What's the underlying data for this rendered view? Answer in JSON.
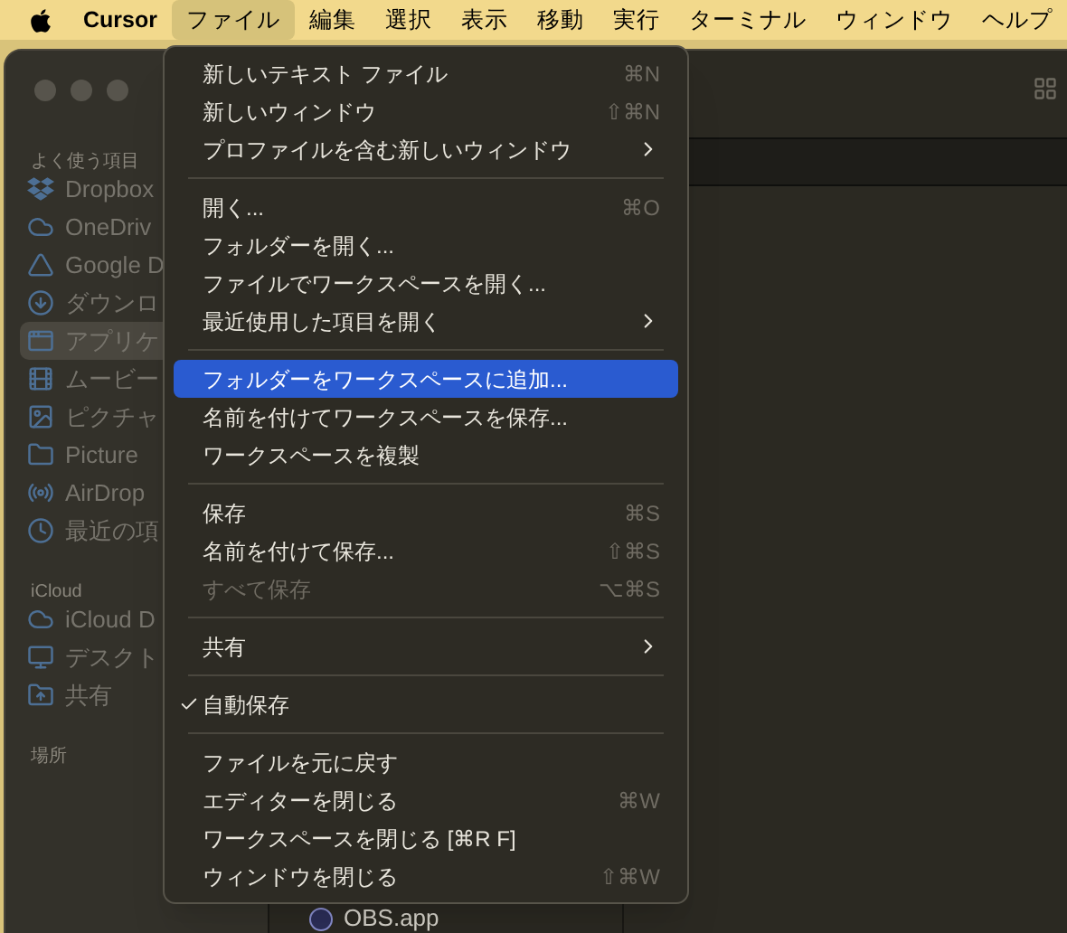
{
  "menu_bar": {
    "app_name": "Cursor",
    "menus": [
      {
        "label": "ファイル",
        "selected": true
      },
      {
        "label": "編集",
        "selected": false
      },
      {
        "label": "選択",
        "selected": false
      },
      {
        "label": "表示",
        "selected": false
      },
      {
        "label": "移動",
        "selected": false
      },
      {
        "label": "実行",
        "selected": false
      },
      {
        "label": "ターミナル",
        "selected": false
      },
      {
        "label": "ウィンドウ",
        "selected": false
      },
      {
        "label": "ヘルプ",
        "selected": false
      }
    ]
  },
  "sidebar": {
    "sections": [
      {
        "title": "よく使う項目",
        "items": [
          {
            "label": "Dropbox",
            "selected": false
          },
          {
            "label": "OneDriv",
            "selected": false
          },
          {
            "label": "Google D",
            "selected": false
          },
          {
            "label": "ダウンロ",
            "selected": false
          },
          {
            "label": "アプリケ",
            "selected": true
          },
          {
            "label": "ムービー",
            "selected": false
          },
          {
            "label": "ピクチャ",
            "selected": false
          },
          {
            "label": "Picture",
            "selected": false
          },
          {
            "label": "AirDrop",
            "selected": false
          },
          {
            "label": "最近の項",
            "selected": false
          }
        ]
      },
      {
        "title": "iCloud",
        "items": [
          {
            "label": "iCloud D",
            "selected": false
          },
          {
            "label": "デスクト",
            "selected": false
          },
          {
            "label": "共有",
            "selected": false
          }
        ]
      },
      {
        "title": "場所"
      }
    ]
  },
  "file_list": [
    {
      "label": "OBS.app"
    }
  ],
  "file_menu": {
    "groups": [
      [
        {
          "label": "新しいテキスト ファイル",
          "shortcut": "⌘N",
          "submenu": false,
          "selected": false,
          "disabled": false,
          "checked": false
        },
        {
          "label": "新しいウィンドウ",
          "shortcut": "⇧⌘N",
          "submenu": false,
          "selected": false,
          "disabled": false,
          "checked": false
        },
        {
          "label": "プロファイルを含む新しいウィンドウ",
          "submenu": true,
          "selected": false,
          "disabled": false,
          "checked": false
        }
      ],
      [
        {
          "label": "開く...",
          "shortcut": "⌘O",
          "submenu": false,
          "selected": false,
          "disabled": false,
          "checked": false
        },
        {
          "label": "フォルダーを開く...",
          "submenu": false,
          "selected": false,
          "disabled": false,
          "checked": false
        },
        {
          "label": "ファイルでワークスペースを開く...",
          "submenu": false,
          "selected": false,
          "disabled": false,
          "checked": false
        },
        {
          "label": "最近使用した項目を開く",
          "submenu": true,
          "selected": false,
          "disabled": false,
          "checked": false
        }
      ],
      [
        {
          "label": "フォルダーをワークスペースに追加...",
          "submenu": false,
          "selected": true,
          "disabled": false,
          "checked": false
        },
        {
          "label": "名前を付けてワークスペースを保存...",
          "submenu": false,
          "selected": false,
          "disabled": false,
          "checked": false
        },
        {
          "label": "ワークスペースを複製",
          "submenu": false,
          "selected": false,
          "disabled": false,
          "checked": false
        }
      ],
      [
        {
          "label": "保存",
          "shortcut": "⌘S",
          "submenu": false,
          "selected": false,
          "disabled": false,
          "checked": false
        },
        {
          "label": "名前を付けて保存...",
          "shortcut": "⇧⌘S",
          "submenu": false,
          "selected": false,
          "disabled": false,
          "checked": false
        },
        {
          "label": "すべて保存",
          "shortcut": "⌥⌘S",
          "submenu": false,
          "selected": false,
          "disabled": true,
          "checked": false
        }
      ],
      [
        {
          "label": "共有",
          "submenu": true,
          "selected": false,
          "disabled": false,
          "checked": false
        }
      ],
      [
        {
          "label": "自動保存",
          "submenu": false,
          "selected": false,
          "disabled": false,
          "checked": true
        }
      ],
      [
        {
          "label": "ファイルを元に戻す",
          "submenu": false,
          "selected": false,
          "disabled": false,
          "checked": false
        },
        {
          "label": "エディターを閉じる",
          "shortcut": "⌘W",
          "submenu": false,
          "selected": false,
          "disabled": false,
          "checked": false
        },
        {
          "label": "ワークスペースを閉じる [⌘R F]",
          "submenu": false,
          "selected": false,
          "disabled": false,
          "checked": false
        },
        {
          "label": "ウィンドウを閉じる",
          "shortcut": "⇧⌘W",
          "submenu": false,
          "selected": false,
          "disabled": false,
          "checked": false
        }
      ]
    ]
  }
}
